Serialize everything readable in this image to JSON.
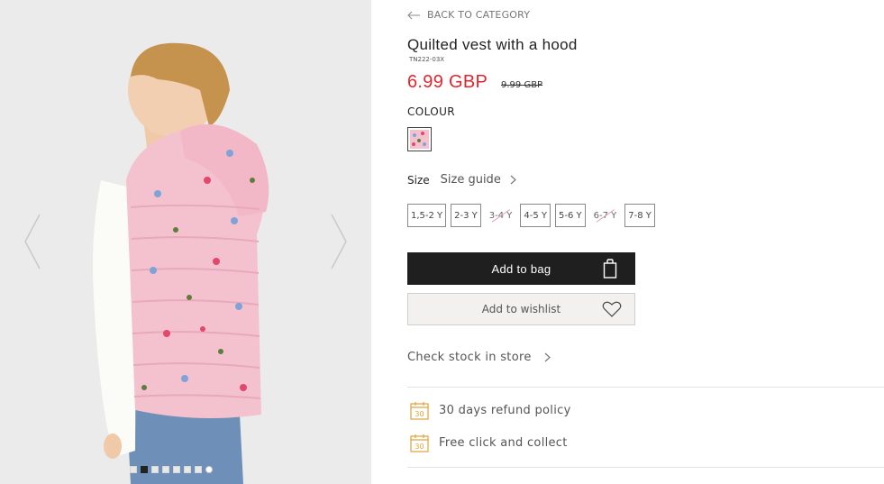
{
  "gallery": {
    "dots": [
      {
        "active": false,
        "round": false
      },
      {
        "active": true,
        "round": false
      },
      {
        "active": false,
        "round": false
      },
      {
        "active": false,
        "round": false
      },
      {
        "active": false,
        "round": false
      },
      {
        "active": false,
        "round": false
      },
      {
        "active": false,
        "round": false
      },
      {
        "active": false,
        "round": true
      }
    ]
  },
  "nav": {
    "back_label": "BACK TO CATEGORY"
  },
  "product": {
    "title": "Quilted vest with a hood",
    "sku": "TN222-03X",
    "price": "6.99 GBP",
    "old_price": "9.99 GBP",
    "colour_label": "COLOUR",
    "swatch_color": "#f4c2cf"
  },
  "size": {
    "label": "Size",
    "guide_label": "Size guide",
    "options": [
      {
        "label": "1,5-2 Y",
        "available": true
      },
      {
        "label": "2-3 Y",
        "available": true
      },
      {
        "label": "3-4 Y",
        "available": false
      },
      {
        "label": "4-5 Y",
        "available": true
      },
      {
        "label": "5-6 Y",
        "available": true
      },
      {
        "label": "6-7 Y",
        "available": false
      },
      {
        "label": "7-8 Y",
        "available": true
      }
    ]
  },
  "actions": {
    "add_to_bag": "Add to bag",
    "add_to_wishlist": "Add to wishlist",
    "check_stock": "Check stock in store"
  },
  "features": [
    {
      "label": "30 days refund policy",
      "icon": "calendar-30-icon",
      "icon_text": "30"
    },
    {
      "label": "Free click and collect",
      "icon": "calendar-30-icon",
      "icon_text": "30"
    }
  ],
  "colors": {
    "price": "#e0262d",
    "accent_icon": "#e0a33a",
    "button": "#1f1f1f"
  }
}
